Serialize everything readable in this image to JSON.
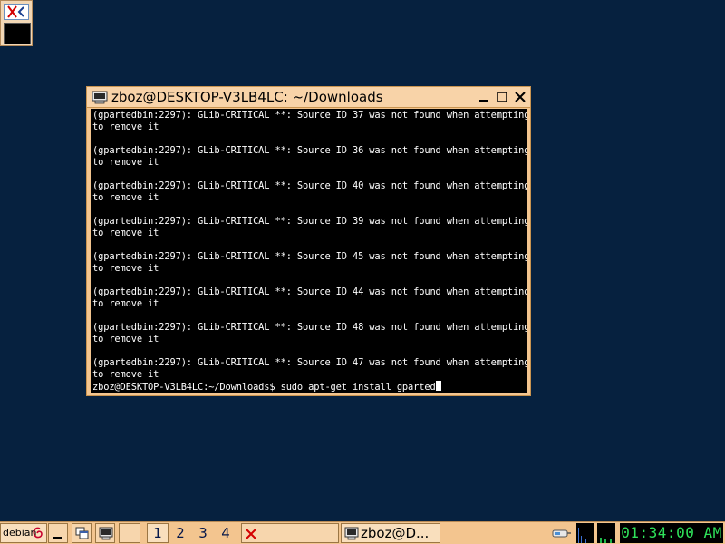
{
  "terminal": {
    "title": "zboz@DESKTOP-V3LB4LC: ~/Downloads",
    "output_lines": [
      "(gpartedbin:2297): GLib-CRITICAL **: Source ID 37 was not found when attempting",
      "to remove it",
      "",
      "(gpartedbin:2297): GLib-CRITICAL **: Source ID 36 was not found when attempting",
      "to remove it",
      "",
      "(gpartedbin:2297): GLib-CRITICAL **: Source ID 40 was not found when attempting",
      "to remove it",
      "",
      "(gpartedbin:2297): GLib-CRITICAL **: Source ID 39 was not found when attempting",
      "to remove it",
      "",
      "(gpartedbin:2297): GLib-CRITICAL **: Source ID 45 was not found when attempting",
      "to remove it",
      "",
      "(gpartedbin:2297): GLib-CRITICAL **: Source ID 44 was not found when attempting",
      "to remove it",
      "",
      "(gpartedbin:2297): GLib-CRITICAL **: Source ID 48 was not found when attempting",
      "to remove it",
      "",
      "(gpartedbin:2297): GLib-CRITICAL **: Source ID 47 was not found when attempting",
      "to remove it"
    ],
    "prompt": "zboz@DESKTOP-V3LB4LC:~/Downloads$ ",
    "command": "sudo apt-get install gparted"
  },
  "taskbar": {
    "start_label": "debian",
    "workspaces": [
      "1",
      "2",
      "3",
      "4"
    ],
    "active_workspace": "1",
    "task_label": "zboz@D...",
    "clock": "01:34:00 AM"
  },
  "colors": {
    "desktop": "#06213f",
    "panel": "#f3c58f",
    "clock_text": "#2fe25a",
    "close_x": "#d40000"
  }
}
